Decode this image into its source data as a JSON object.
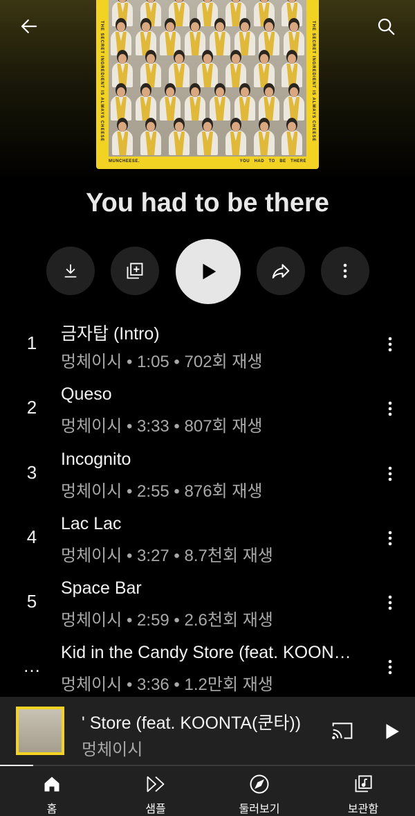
{
  "header": {
    "back_icon": "arrow-left-icon",
    "search_icon": "search-icon"
  },
  "album": {
    "title": "You had to be there",
    "cover_side_left": "THE SECRET INGREDIENT IS ALWAYS CHEESE",
    "cover_side_right": "THE SECRET INGREDIENT IS ALWAYS CHEESE",
    "cover_footer_left": "MUNCHEESE.",
    "cover_footer_right": "YOU   HAD   TO   BE   THERE",
    "accent_color": "#f2d324"
  },
  "actions": {
    "download_icon": "download-icon",
    "add_to_playlist_icon": "playlist-add-icon",
    "play_icon": "play-icon",
    "share_icon": "share-icon",
    "more_icon": "more-vertical-icon"
  },
  "tracks": [
    {
      "number": "1",
      "title": "금자탑 (Intro)",
      "meta": "멍체이시 • 1:05 • 702회 재생"
    },
    {
      "number": "2",
      "title": "Queso",
      "meta": "멍체이시 • 3:33 • 807회 재생"
    },
    {
      "number": "3",
      "title": "Incognito",
      "meta": "멍체이시 • 2:55 • 876회 재생"
    },
    {
      "number": "4",
      "title": "Lac Lac",
      "meta": "멍체이시 • 3:27 • 8.7천회 재생"
    },
    {
      "number": "5",
      "title": "Space Bar",
      "meta": "멍체이시 • 2:59 • 2.6천회 재생"
    },
    {
      "number": "…",
      "title": "Kid in the Candy Store (feat. KOON…",
      "meta": "멍체이시 • 3:36 • 1.2만회 재생"
    }
  ],
  "mini_player": {
    "title": "' Store (feat. KOONTA(쿤타))",
    "artist": "멍체이시",
    "cast_icon": "cast-icon",
    "play_icon": "play-icon",
    "progress_fraction": 0.08
  },
  "bottom_nav": [
    {
      "label": "홈",
      "icon": "home-icon"
    },
    {
      "label": "샘플",
      "icon": "samples-icon"
    },
    {
      "label": "둘러보기",
      "icon": "explore-compass-icon"
    },
    {
      "label": "보관함",
      "icon": "library-icon"
    }
  ]
}
